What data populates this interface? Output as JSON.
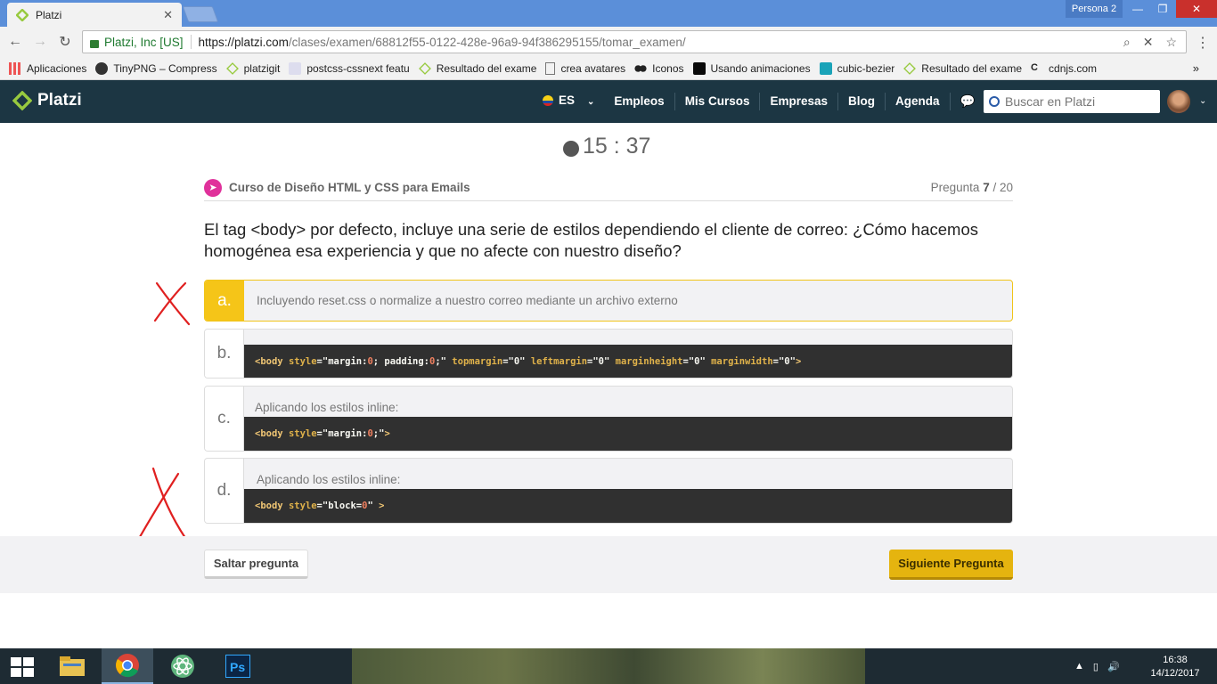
{
  "browser": {
    "tab_title": "Platzi",
    "persona": "Persona 2",
    "secure_label": "Platzi, Inc [US]",
    "url_host": "https://platzi.com",
    "url_path": "/clases/examen/68812f55-0122-428e-96a9-94f386295155/tomar_examen/",
    "bookmarks": [
      "Aplicaciones",
      "TinyPNG – Compress",
      "platzigit",
      "postcss-cssnext featu",
      "Resultado del exame",
      "crea avatares",
      "Iconos",
      "Usando animaciones",
      "cubic-bezier",
      "Resultado del exame",
      "cdnjs.com"
    ],
    "bookmarks_more": "»"
  },
  "header": {
    "logo": "Platzi",
    "lang": "ES",
    "nav": [
      "Empleos",
      "Mis Cursos",
      "Empresas",
      "Blog",
      "Agenda"
    ],
    "search_placeholder": "Buscar en Platzi"
  },
  "exam": {
    "timer": "15 : 37",
    "course": "Curso de Diseño HTML y CSS para Emails",
    "question_prefix": "Pregunta",
    "question_current": "7",
    "question_total": "/ 20",
    "question": "El tag <body> por defecto, incluye una serie de estilos dependiendo el cliente de correo: ¿Cómo hacemos homogénea esa experiencia y que no afecte con nuestro diseño?",
    "options": [
      {
        "letter": "a.",
        "text": "Incluyendo reset.css o normalize a nuestro correo mediante un archivo externo"
      },
      {
        "letter": "b.",
        "label": ""
      },
      {
        "letter": "c.",
        "label": "Aplicando los estilos inline:"
      },
      {
        "letter": "d.",
        "label": "Aplicando los estilos inline:"
      }
    ],
    "code": {
      "b": [
        {
          "t": "tag",
          "v": "<body "
        },
        {
          "t": "attr",
          "v": "style"
        },
        {
          "t": "str",
          "v": "=\"margin:"
        },
        {
          "t": "num",
          "v": "0"
        },
        {
          "t": "str",
          "v": "; padding:"
        },
        {
          "t": "num",
          "v": "0"
        },
        {
          "t": "str",
          "v": ";\" "
        },
        {
          "t": "attr",
          "v": "topmargin"
        },
        {
          "t": "str",
          "v": "=\"0\" "
        },
        {
          "t": "attr",
          "v": "leftmargin"
        },
        {
          "t": "str",
          "v": "=\"0\" "
        },
        {
          "t": "attr",
          "v": "marginheight"
        },
        {
          "t": "str",
          "v": "=\"0\" "
        },
        {
          "t": "attr",
          "v": "marginwidth"
        },
        {
          "t": "str",
          "v": "=\"0\""
        },
        {
          "t": "tag",
          "v": ">"
        }
      ],
      "c": [
        {
          "t": "tag",
          "v": "<body "
        },
        {
          "t": "attr",
          "v": "style"
        },
        {
          "t": "str",
          "v": "=\"margin:"
        },
        {
          "t": "num",
          "v": "0"
        },
        {
          "t": "str",
          "v": ";\""
        },
        {
          "t": "tag",
          "v": ">"
        }
      ],
      "d": [
        {
          "t": "tag",
          "v": "<body "
        },
        {
          "t": "attr",
          "v": "style"
        },
        {
          "t": "str",
          "v": "=\"block="
        },
        {
          "t": "num",
          "v": "0"
        },
        {
          "t": "str",
          "v": "\" "
        },
        {
          "t": "tag",
          "v": ">"
        }
      ]
    },
    "skip_label": "Saltar pregunta",
    "next_label": "Siguiente Pregunta"
  },
  "taskbar": {
    "time": "16:38",
    "date": "14/12/2017"
  },
  "colors": {
    "header_bg": "#1c3643",
    "accent_yellow": "#f5c518",
    "next_button": "#e5b40f",
    "platzi_green": "#98ca3f",
    "annotation_red": "#e02020"
  }
}
